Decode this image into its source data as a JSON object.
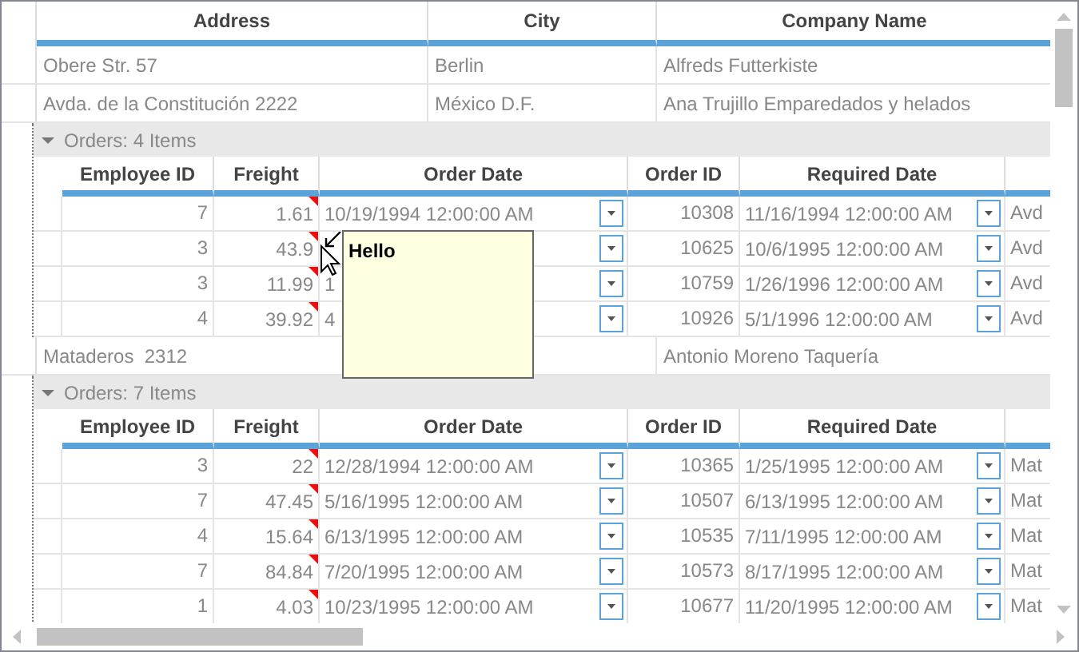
{
  "columns": [
    "Address",
    "City",
    "Company Name"
  ],
  "customers": [
    {
      "address": "Obere Str. 57",
      "city": "Berlin",
      "company_name": "Alfreds Futterkiste"
    },
    {
      "address": "Avda. de la Constitución 2222",
      "city": "México D.F.",
      "company_name": "Ana Trujillo Emparedados y helados",
      "orders": {
        "label": "Orders: 4 Items",
        "expanded": true,
        "columns": [
          "Employee ID",
          "Freight",
          "Order Date",
          "Order ID",
          "Required Date"
        ],
        "rows": [
          {
            "employee_id": "7",
            "freight": "1.61",
            "has_comment": true,
            "order_date": "10/19/1994 12:00:00 AM",
            "order_id": "10308",
            "required_date": "11/16/1994 12:00:00 AM",
            "column_6": "Avd"
          },
          {
            "employee_id": "3",
            "freight": "43.9",
            "has_comment": true,
            "order_id": "10625",
            "required_date": "10/6/1995 12:00:00 AM",
            "column_6": "Avd"
          },
          {
            "employee_id": "3",
            "freight": "11.99",
            "has_comment": true,
            "order_date": "1",
            "order_id": "10759",
            "required_date": "1/26/1996 12:00:00 AM",
            "column_6": "Avd"
          },
          {
            "employee_id": "4",
            "freight": "39.92",
            "has_comment": true,
            "order_date": "4",
            "order_id": "10926",
            "required_date": "5/1/1996 12:00:00 AM",
            "column_6": "Avd"
          }
        ]
      }
    },
    {
      "address": "Mataderos  2312",
      "company_name": "Antonio Moreno Taquería",
      "orders": {
        "label": "Orders: 7 Items",
        "expanded": true,
        "columns": [
          "Employee ID",
          "Freight",
          "Order Date",
          "Order ID",
          "Required Date"
        ],
        "rows": [
          {
            "employee_id": "3",
            "freight": "22",
            "has_comment": true,
            "order_date": "12/28/1994 12:00:00 AM",
            "order_id": "10365",
            "required_date": "1/25/1995 12:00:00 AM",
            "column_6": "Mat"
          },
          {
            "employee_id": "7",
            "freight": "47.45",
            "has_comment": true,
            "order_date": "5/16/1995 12:00:00 AM",
            "order_id": "10507",
            "required_date": "6/13/1995 12:00:00 AM",
            "column_6": "Mat"
          },
          {
            "employee_id": "4",
            "freight": "15.64",
            "has_comment": true,
            "order_date": "6/13/1995 12:00:00 AM",
            "order_id": "10535",
            "required_date": "7/11/1995 12:00:00 AM",
            "column_6": "Mat"
          },
          {
            "employee_id": "7",
            "freight": "84.84",
            "has_comment": true,
            "order_date": "7/20/1995 12:00:00 AM",
            "order_id": "10573",
            "required_date": "8/17/1995 12:00:00 AM",
            "column_6": "Mat"
          },
          {
            "employee_id": "1",
            "freight": "4.03",
            "has_comment": true,
            "order_date": "10/23/1995 12:00:00 AM",
            "order_id": "10677",
            "required_date": "11/20/1995 12:00:00 AM",
            "column_6": "Mat"
          }
        ]
      }
    }
  ],
  "tooltip": {
    "text": "Hello"
  }
}
